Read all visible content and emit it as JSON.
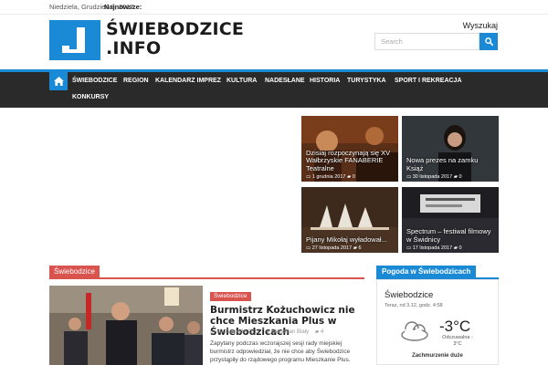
{
  "topbar": {
    "date": "Niedziela, Grudzień 3, 2017",
    "latest_label": "Najnowsze:"
  },
  "logo": {
    "line1": "ŚWIEBODZICE",
    "line2": ".INFO"
  },
  "search": {
    "label": "Wyszukaj",
    "placeholder": "Search"
  },
  "nav": {
    "items": [
      {
        "label": "ŚWIEBODZICE"
      },
      {
        "label": "REGION"
      },
      {
        "label": "KALENDARZ IMPREZ"
      },
      {
        "label": "KULTURA"
      },
      {
        "label": "NADESŁANE"
      },
      {
        "label": "HISTORIA"
      },
      {
        "label": "TURYSTYKA"
      },
      {
        "label": "SPORT I REKREACJA"
      },
      {
        "label": "KONKURSY"
      }
    ]
  },
  "featured": [
    {
      "title": "Dzisiaj rozpoczynają się XV Wałbrzyskie FANABERIE Teatralne",
      "date": "1 grudnia 2017",
      "comments": "0"
    },
    {
      "title": "Nowa prezes na zamku Książ",
      "date": "30 listopada 2017",
      "comments": "0"
    },
    {
      "title": "Pijany Mikołaj wyładował...",
      "date": "27 listopada 2017",
      "comments": "6"
    },
    {
      "title": "Spectrum – festiwal filmowy w Świdnicy",
      "date": "17 listopada 2017",
      "comments": "0"
    }
  ],
  "section": {
    "label": "Świebodzice"
  },
  "article": {
    "category": "Świebodzice",
    "title": "Burmistrz Kożuchowicz nie chce Mieszkania Plus w Świebodzicach",
    "date": "30 listopada 2017",
    "author": "Sebastian Biały",
    "comments": "4",
    "excerpt": "Zapytany podczas wczorajszej sesji rady miejskiej burmistrz odpowiedział, że nie chce aby Świebodzice przystąpiły do rządowego programu Mieszkanie Plus."
  },
  "weather": {
    "header": "Pogoda w Świebodzicach",
    "city": "Świebodzice",
    "time": "Teraz, nd 3.12, godz. 4:58",
    "temp": "-3°C",
    "feels_label": "Odczuwalna -",
    "feels_value": "3°C",
    "description": "Zachmurzenie duże"
  },
  "colors": {
    "accent": "#1a8ad6",
    "section_red": "#d9534f",
    "nav_bg": "#2a2a2a"
  }
}
